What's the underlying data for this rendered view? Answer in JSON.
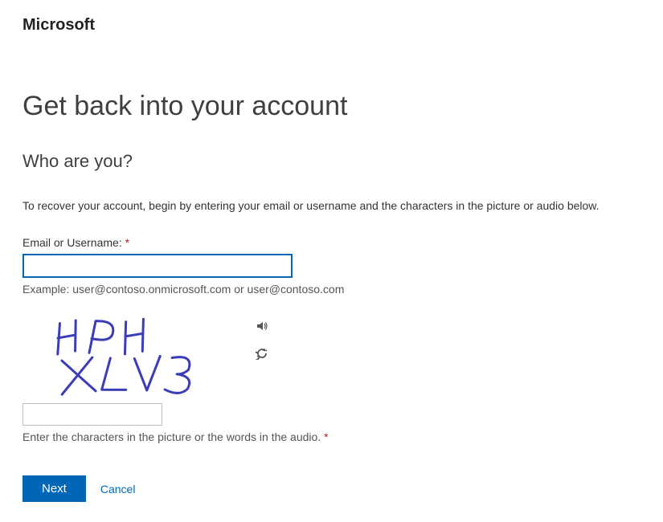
{
  "brand": "Microsoft",
  "page_title": "Get back into your account",
  "subtitle": "Who are you?",
  "instruction": "To recover your account, begin by entering your email or username and the characters in the picture or audio below.",
  "email_field": {
    "label": "Email or Username:",
    "required_marker": "*",
    "value": "",
    "hint": "Example: user@contoso.onmicrosoft.com or user@contoso.com"
  },
  "captcha": {
    "image_text": "HPH XLV3",
    "audio_icon": "speaker-icon",
    "refresh_icon": "refresh-icon",
    "input_value": "",
    "hint": "Enter the characters in the picture or the words in the audio.",
    "required_marker": "*"
  },
  "buttons": {
    "next": "Next",
    "cancel": "Cancel"
  },
  "colors": {
    "primary": "#0067b8",
    "required": "#a4262c"
  }
}
